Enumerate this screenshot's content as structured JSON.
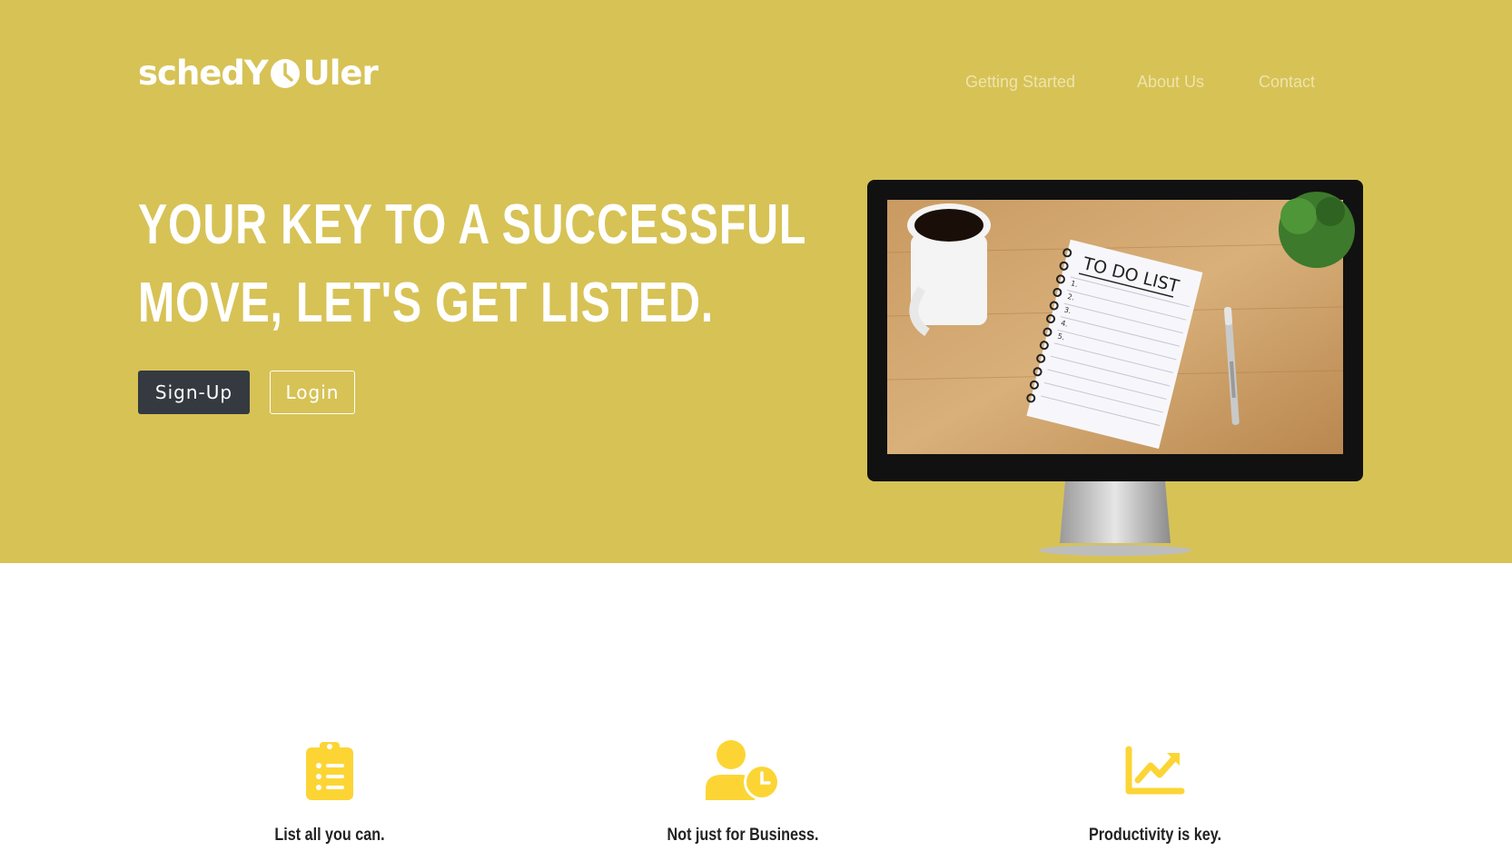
{
  "brand": {
    "name_part1": "schedY",
    "name_part2": "Uler"
  },
  "nav": {
    "items": [
      "Getting Started",
      "About Us",
      "Contact"
    ]
  },
  "hero": {
    "headline_line1": "YOUR KEY TO A SUCCESSFUL",
    "headline_line2": "MOVE, LET'S GET LISTED.",
    "signup_label": "Sign-Up",
    "login_label": "Login",
    "image_text": {
      "title": "TO DO LIST",
      "items": [
        "1.",
        "2.",
        "3.",
        "4.",
        "5."
      ]
    }
  },
  "features": [
    {
      "icon": "clipboard-list-icon",
      "label": "List all you can."
    },
    {
      "icon": "user-clock-icon",
      "label": "Not just for Business."
    },
    {
      "icon": "chart-line-icon",
      "label": "Productivity is key."
    }
  ],
  "colors": {
    "hero_bg": "#d7c256",
    "accent_yellow": "#fcd535",
    "dark_button": "#343a40"
  }
}
